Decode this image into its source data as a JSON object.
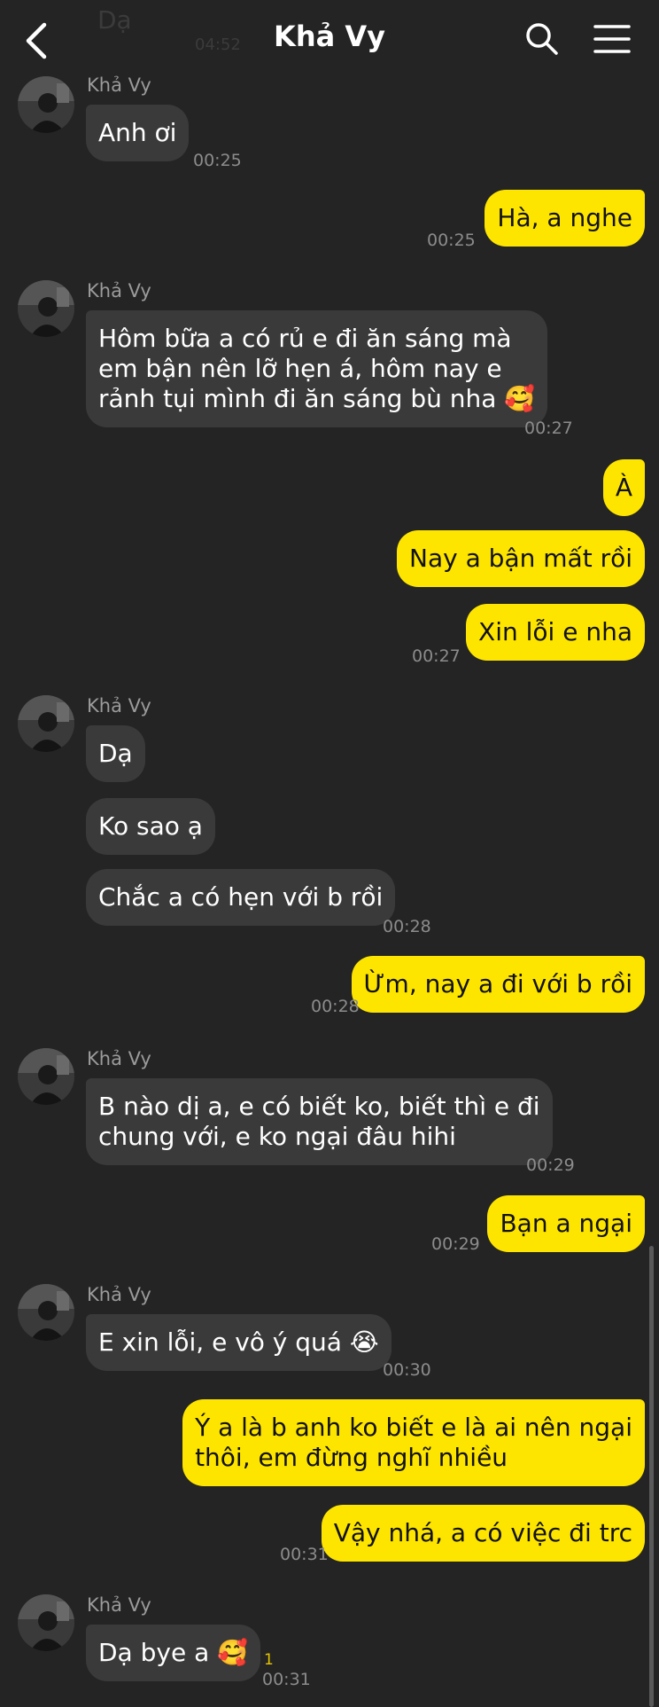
{
  "header": {
    "title": "Khả Vy",
    "prev_message_ghost": "Dạ",
    "prev_time_ghost": "04:52",
    "back_icon": "chevron-left-icon",
    "search_icon": "search-icon",
    "menu_icon": "menu-icon"
  },
  "contact": {
    "name": "Khả Vy"
  },
  "messages": [
    {
      "text": "Anh ơi",
      "time": "00:25"
    },
    {
      "text": "Hà, a nghe",
      "time": "00:25"
    },
    {
      "lines": [
        "Hôm bữa a có rủ e đi ăn sáng mà",
        "em bận nên lỡ hẹn á, hôm nay e",
        "rảnh tụi mình đi ăn sáng bù nha"
      ],
      "emoji": "🥰",
      "time": "00:27"
    },
    {
      "text": "À"
    },
    {
      "text": "Nay a bận mất rồi"
    },
    {
      "text": "Xin lỗi e nha",
      "time": "00:27"
    },
    {
      "text": "Dạ"
    },
    {
      "text": "Ko sao ạ"
    },
    {
      "text": "Chắc a có hẹn với b rồi",
      "time": "00:28"
    },
    {
      "text": "Ừm, nay a đi với b rồi",
      "time": "00:28"
    },
    {
      "lines": [
        "B nào dị a, e có biết ko, biết thì e đi",
        "chung với, e ko ngại đâu hihi"
      ],
      "time": "00:29"
    },
    {
      "text": "Bạn a ngại",
      "time": "00:29"
    },
    {
      "text": "E xin lỗi, e vô ý quá",
      "emoji": "😭",
      "time": "00:30"
    },
    {
      "lines": [
        "Ý a là b anh ko biết e là ai nên ngại",
        "thôi, em đừng nghĩ nhiều"
      ]
    },
    {
      "text": "Vậy nhá, a có việc đi trc",
      "time": "00:31"
    },
    {
      "text": "Dạ bye a",
      "emoji": "🥰",
      "time": "00:31",
      "unread": "1"
    }
  ],
  "colors": {
    "background": "#242424",
    "incoming_bubble": "#3a3a3a",
    "outgoing_bubble": "#fee500",
    "time_text": "#8c8c8c",
    "name_text": "#9b9b9b"
  }
}
